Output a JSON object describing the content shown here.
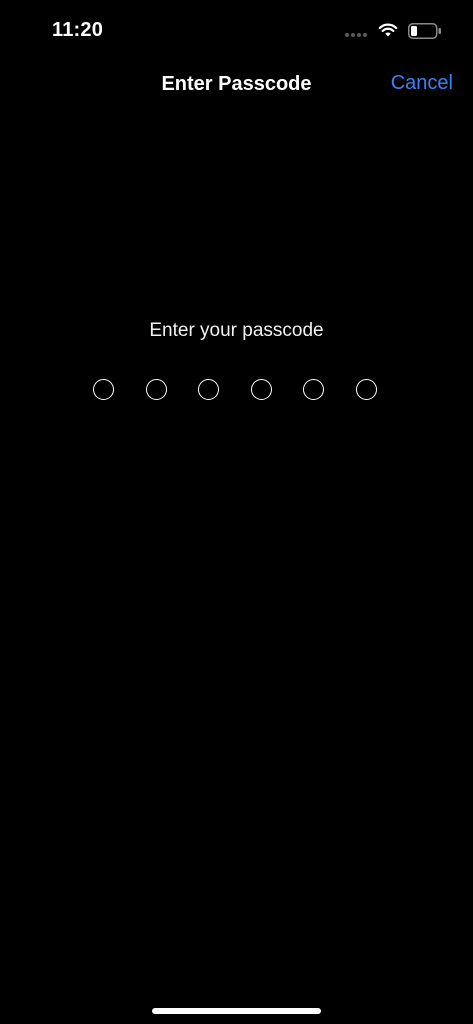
{
  "status_bar": {
    "time": "11:20",
    "icons": [
      "signal-dots-icon",
      "wifi-icon",
      "battery-icon"
    ]
  },
  "nav": {
    "title": "Enter Passcode",
    "cancel_label": "Cancel"
  },
  "passcode": {
    "prompt": "Enter your passcode",
    "length": 6,
    "entered": 0
  },
  "colors": {
    "background": "#000000",
    "text": "#ffffff",
    "accent": "#3b82f6"
  }
}
